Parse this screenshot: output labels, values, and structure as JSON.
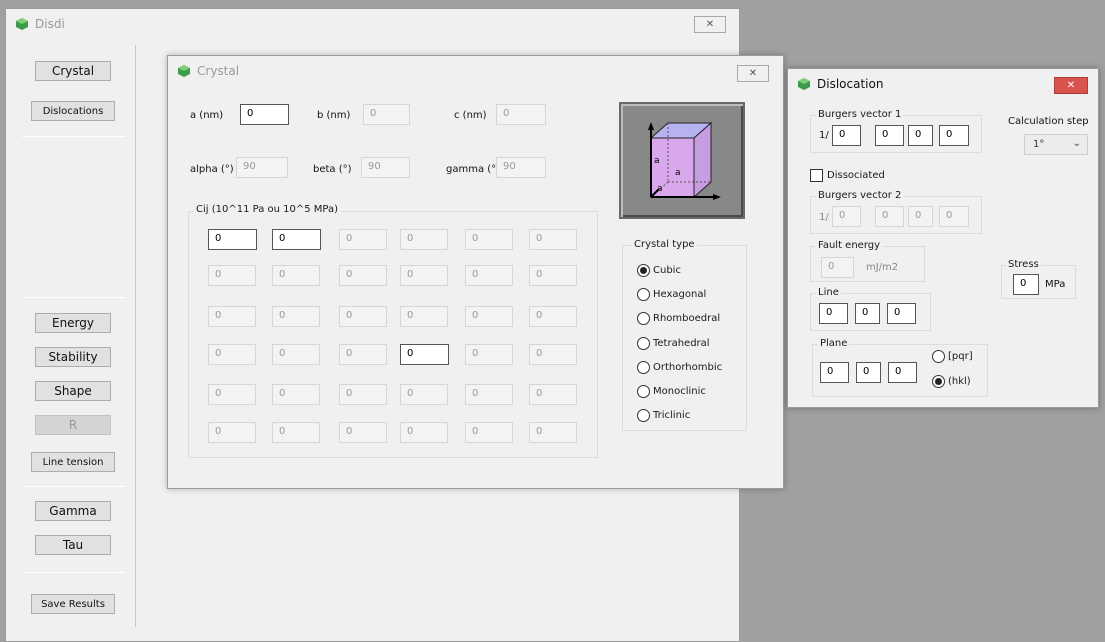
{
  "main": {
    "title": "Disdi",
    "close": "✕",
    "buttons": {
      "crystal": "Crystal",
      "dislocations": "Dislocations",
      "energy": "Energy",
      "stability": "Stability",
      "shape": "Shape",
      "r": "R",
      "line_tension": "Line tension",
      "gamma": "Gamma",
      "tau": "Tau",
      "save_results": "Save Results"
    }
  },
  "crystal": {
    "title": "Crystal",
    "close": "✕",
    "a_label": "a (nm)",
    "a_value": "0",
    "b_label": "b (nm)",
    "b_value": "0",
    "c_label": "c (nm)",
    "c_value": "0",
    "alpha_label": "alpha (°)",
    "alpha_value": "90",
    "beta_label": "beta (°)",
    "beta_value": "90",
    "gamma_label": "gamma (°)",
    "gamma_value": "90",
    "cij_title": "Cij  (10^11 Pa ou 10^5 MPa)",
    "cij": [
      [
        "0",
        "0",
        "0",
        "0",
        "0",
        "0"
      ],
      [
        "0",
        "0",
        "0",
        "0",
        "0",
        "0"
      ],
      [
        "0",
        "0",
        "0",
        "0",
        "0",
        "0"
      ],
      [
        "0",
        "0",
        "0",
        "0",
        "0",
        "0"
      ],
      [
        "0",
        "0",
        "0",
        "0",
        "0",
        "0"
      ],
      [
        "0",
        "0",
        "0",
        "0",
        "0",
        "0"
      ]
    ],
    "cube_axis_label": "a",
    "crystal_type_title": "Crystal type",
    "crystal_types": [
      "Cubic",
      "Hexagonal",
      "Rhomboedral",
      "Tetrahedral",
      "Orthorhombic",
      "Monoclinic",
      "Triclinic"
    ],
    "selected_type": "Cubic"
  },
  "dislocation": {
    "title": "Dislocation",
    "close": "✕",
    "burgers1_title": "Burgers vector 1",
    "burgers_prefix": "1/",
    "burgers1_values": [
      "0",
      "0",
      "0",
      "0"
    ],
    "calc_step_label": "Calculation step",
    "calc_step_value": "1°",
    "dissociated_label": "Dissociated",
    "burgers2_title": "Burgers vector 2",
    "burgers2_values": [
      "0",
      "0",
      "0",
      "0"
    ],
    "fault_title": "Fault energy",
    "fault_value": "0",
    "fault_unit": "mJ/m2",
    "stress_title": "Stress",
    "stress_value": "0",
    "stress_unit": "MPa",
    "line_title": "Line",
    "line_values": [
      "0",
      "0",
      "0"
    ],
    "plane_title": "Plane",
    "plane_values": [
      "0",
      "0",
      "0"
    ],
    "plane_options": [
      "[pqr]",
      "(hkl)"
    ],
    "plane_selected": "(hkl)"
  },
  "colors": {
    "cube_face": "#d9a8ec",
    "cube_top": "#b7b3f0",
    "close_red": "#d9534f"
  }
}
